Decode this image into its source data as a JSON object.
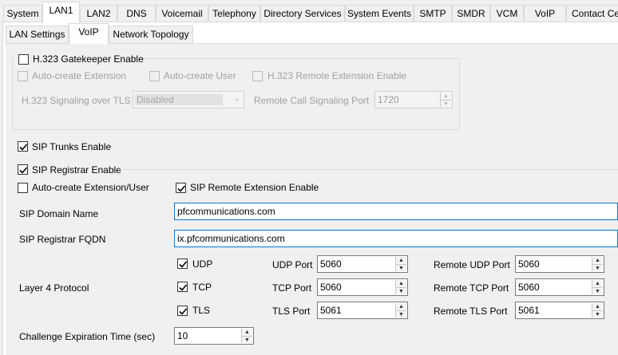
{
  "top_tabs": [
    "System",
    "LAN1",
    "LAN2",
    "DNS",
    "Voicemail",
    "Telephony",
    "Directory Services",
    "System Events",
    "SMTP",
    "SMDR",
    "VCM",
    "VoIP",
    "Contact Ce"
  ],
  "top_tab_active": "LAN1",
  "sub_tabs": [
    "LAN Settings",
    "VoIP",
    "Network Topology"
  ],
  "sub_tab_active": "VoIP",
  "h323": {
    "gatekeeper_label": "H.323 Gatekeeper Enable",
    "auto_ext_label": "Auto-create Extension",
    "auto_user_label": "Auto-create User",
    "remote_ext_label": "H.323 Remote Extension Enable",
    "signaling_tls_label": "H.323 Signaling over TLS",
    "signaling_tls_value": "Disabled",
    "remote_port_label": "Remote Call Signaling Port",
    "remote_port_value": "1720"
  },
  "sip": {
    "trunks_label": "SIP Trunks Enable",
    "registrar_label": "SIP Registrar Enable",
    "auto_create_label": "Auto-create Extension/User",
    "remote_ext_label": "SIP Remote Extension Enable",
    "domain_label": "SIP Domain Name",
    "domain_value": "pfcommunications.com",
    "fqdn_label": "SIP Registrar FQDN",
    "fqdn_value": "ix.pfcommunications.com",
    "layer4_label": "Layer 4 Protocol",
    "udp_label": "UDP",
    "tcp_label": "TCP",
    "tls_label": "TLS",
    "udp_port_label": "UDP Port",
    "udp_port_value": "5060",
    "tcp_port_label": "TCP Port",
    "tcp_port_value": "5060",
    "tls_port_label": "TLS Port",
    "tls_port_value": "5061",
    "remote_udp_label": "Remote UDP Port",
    "remote_udp_value": "5060",
    "remote_tcp_label": "Remote TCP Port",
    "remote_tcp_value": "5060",
    "remote_tls_label": "Remote TLS Port",
    "remote_tls_value": "5061",
    "challenge_label": "Challenge Expiration Time (sec)",
    "challenge_value": "10"
  },
  "checked": {
    "h323_gatekeeper": false,
    "sip_trunks": true,
    "sip_registrar": true,
    "auto_create": false,
    "sip_remote_ext": true,
    "udp": true,
    "tcp": true,
    "tls": true
  }
}
